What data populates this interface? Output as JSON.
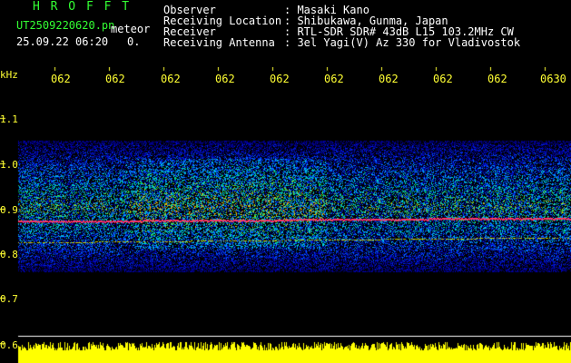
{
  "header": {
    "app_name": "H R O F F T",
    "filename": "UT2509220620.pn",
    "mode": "meteor",
    "date_time": "25.09.22 06:20",
    "count": "0.",
    "fields": [
      {
        "label": "Observer",
        "value": ": Masaki Kano"
      },
      {
        "label": "Receiving Location",
        "value": ": Shibukawa, Gunma, Japan"
      },
      {
        "label": "Receiver",
        "value": ": RTL-SDR SDR# 43dB L15 103.2MHz CW"
      },
      {
        "label": "Receiving Antenna",
        "value": ": 3el Yagi(V) Az 330 for Vladivostok"
      }
    ]
  },
  "spectrogram": {
    "y_unit": "kHz",
    "y_ticks": [
      "1.1",
      "1.0",
      "0.9",
      "0.8",
      "0.7",
      "0.6"
    ],
    "x_ticks": [
      "062",
      "062",
      "062",
      "062",
      "062",
      "062",
      "062",
      "062",
      "062",
      "0630"
    ],
    "colors": {
      "background": "#000000",
      "noise_low": "#0033cc",
      "noise_mid": "#00cc99",
      "noise_high": "#cccc00",
      "signal": "#ff3366",
      "meter_bar": "#ffff00",
      "axis_text": "#ffff33"
    }
  }
}
